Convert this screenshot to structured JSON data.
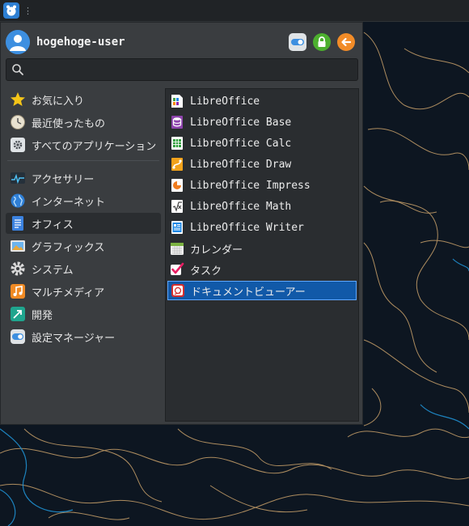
{
  "user": {
    "name": "hogehoge-user"
  },
  "search": {
    "value": "",
    "placeholder": ""
  },
  "categories": [
    {
      "label": "お気に入り",
      "icon": "star-icon"
    },
    {
      "label": "最近使ったもの",
      "icon": "clock-icon"
    },
    {
      "label": "すべてのアプリケーション",
      "icon": "gear-box-icon"
    },
    {
      "label": "アクセサリー",
      "icon": "pulse-icon"
    },
    {
      "label": "インターネット",
      "icon": "globe-icon"
    },
    {
      "label": "オフィス",
      "icon": "document-icon",
      "active": true
    },
    {
      "label": "グラフィックス",
      "icon": "picture-icon"
    },
    {
      "label": "システム",
      "icon": "gear-icon"
    },
    {
      "label": "マルチメディア",
      "icon": "music-icon"
    },
    {
      "label": "開発",
      "icon": "arrow-tool-icon"
    },
    {
      "label": "設定マネージャー",
      "icon": "toggle-icon"
    }
  ],
  "apps": [
    {
      "label": "LibreOffice",
      "icon": "libreoffice-icon"
    },
    {
      "label": "LibreOffice Base",
      "icon": "libreoffice-base-icon"
    },
    {
      "label": "LibreOffice Calc",
      "icon": "libreoffice-calc-icon"
    },
    {
      "label": "LibreOffice Draw",
      "icon": "libreoffice-draw-icon"
    },
    {
      "label": "LibreOffice Impress",
      "icon": "libreoffice-impress-icon"
    },
    {
      "label": "LibreOffice Math",
      "icon": "libreoffice-math-icon"
    },
    {
      "label": "LibreOffice Writer",
      "icon": "libreoffice-writer-icon"
    },
    {
      "label": "カレンダー",
      "icon": "calendar-icon"
    },
    {
      "label": "タスク",
      "icon": "checkmark-icon"
    },
    {
      "label": "ドキュメントビューアー",
      "icon": "document-viewer-icon",
      "selected": true
    }
  ],
  "colors": {
    "selection": "#1159a8",
    "selection_border": "#5fa8ff",
    "menu_bg": "#3a3d40",
    "apps_bg": "#2a2d30",
    "wallpaper_bg": "#0d1621",
    "topo_orange": "#c9a16a",
    "topo_blue": "#1f8fd0"
  }
}
